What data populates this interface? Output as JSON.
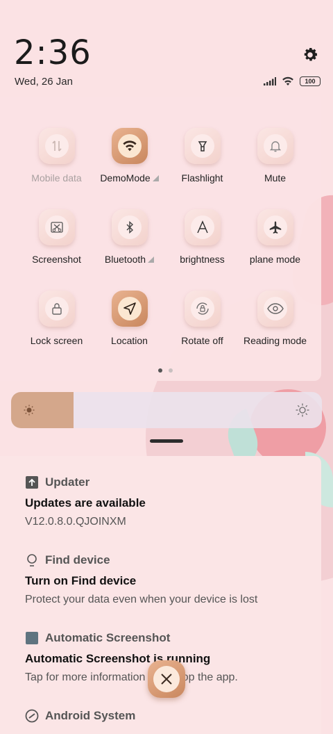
{
  "status": {
    "time": "2:36",
    "date": "Wed, 26 Jan",
    "battery": "100",
    "icons": [
      "signal-icon",
      "wifi-icon",
      "battery-icon"
    ]
  },
  "settings_icon": "gear-icon",
  "tiles": [
    {
      "label": "Mobile data",
      "icon": "mobile-data-icon",
      "active": false,
      "dim": true
    },
    {
      "label": "DemoMode",
      "icon": "wifi-icon",
      "active": true,
      "expand": true
    },
    {
      "label": "Flashlight",
      "icon": "flashlight-icon",
      "active": false
    },
    {
      "label": "Mute",
      "icon": "bell-icon",
      "active": false
    },
    {
      "label": "Screenshot",
      "icon": "scissors-icon",
      "active": false
    },
    {
      "label": "Bluetooth",
      "icon": "bluetooth-icon",
      "active": false,
      "expand": true
    },
    {
      "label": "brightness",
      "icon": "auto-brightness-icon",
      "active": false
    },
    {
      "label": "plane mode",
      "icon": "airplane-icon",
      "active": false
    },
    {
      "label": "Lock screen",
      "icon": "lock-icon",
      "active": false
    },
    {
      "label": "Location",
      "icon": "location-icon",
      "active": true
    },
    {
      "label": "Rotate off",
      "icon": "rotate-lock-icon",
      "active": false
    },
    {
      "label": "Reading mode",
      "icon": "eye-icon",
      "active": false
    }
  ],
  "pager": {
    "pages": 2,
    "current": 1
  },
  "brightness": {
    "level": 0.2,
    "fill_color": "#d4a78b"
  },
  "notifications": [
    {
      "app": "Updater",
      "title": "Updates are available",
      "body": "V12.0.8.0.QJOINXM",
      "icon": "upload-icon"
    },
    {
      "app": "Find device",
      "title": "Turn on Find device",
      "body": "Protect your data even when your device is lost",
      "icon": "location-pin-icon"
    },
    {
      "app": "Automatic Screenshot",
      "title": "Automatic Screenshot is running",
      "body": "Tap for more information or to stop the app.",
      "icon": "square-app-icon"
    },
    {
      "app": "Android System",
      "title": "",
      "body": "",
      "icon": "android-system-icon"
    }
  ],
  "dismiss_icon": "close-icon",
  "colors": {
    "background": "#fbe2e4",
    "accent": "#c9875e"
  }
}
